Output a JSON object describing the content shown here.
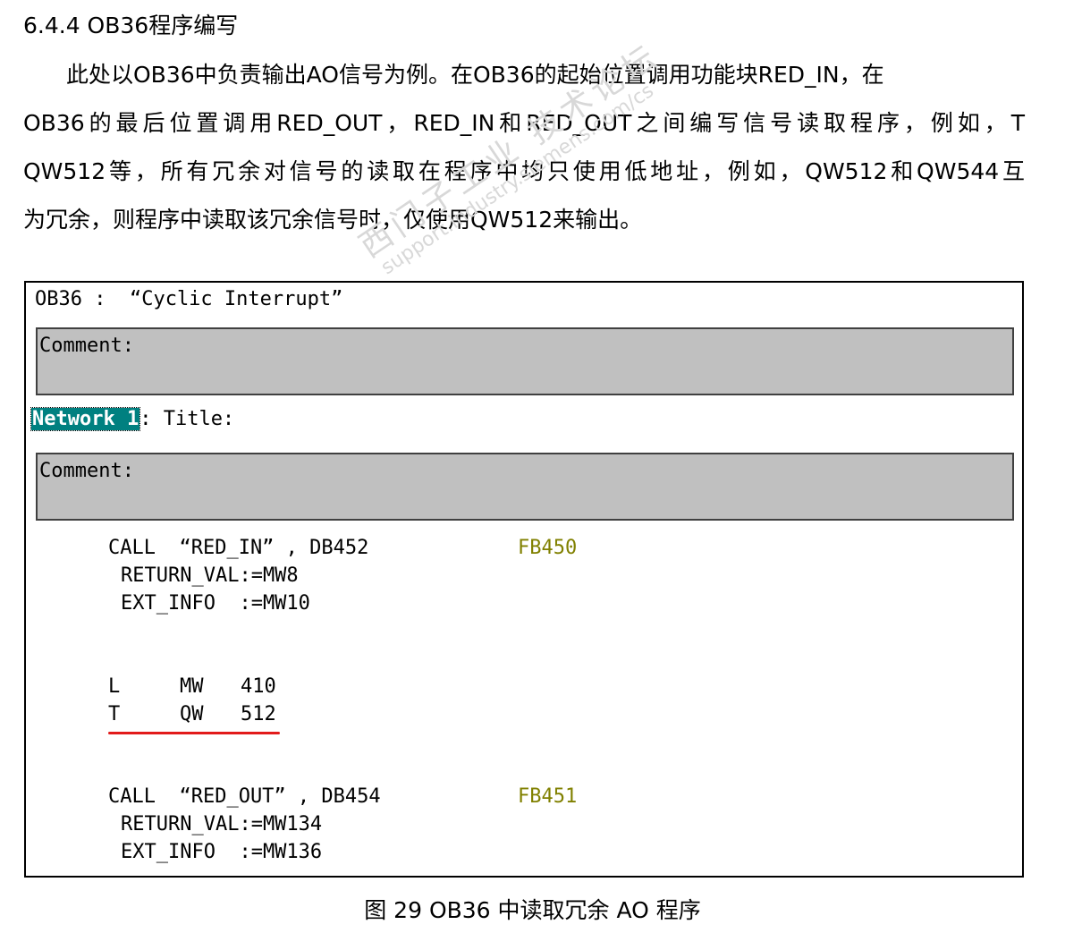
{
  "section": {
    "heading": "6.4.4 OB36程序编写"
  },
  "paragraph": {
    "lines": [
      "此处以OB36中负责输出AO信号为例。在OB36的起始位置调用功能块RED_IN，在",
      "OB36的最后位置调用RED_OUT，RED_IN和RED_OUT之间编写信号读取程序，例如，T",
      "QW512等，所有冗余对信号的读取在程序中均只使用低地址，例如，QW512和QW544互",
      "为冗余，则程序中读取该冗余信号时，仅使用QW512来输出。"
    ]
  },
  "figure": {
    "ob_title": "OB36 :  “Cyclic Interrupt”",
    "comment1": "Comment:",
    "network_label": "Network 1",
    "network_title": ": Title:",
    "comment2": "Comment:",
    "call1": {
      "code": "CALL  “RED_IN” , DB452",
      "fb": "FB450",
      "p1": "RETURN_VAL:=MW8",
      "p2": "EXT_INFO  :=MW10"
    },
    "load": {
      "op": "L",
      "addr": "MW",
      "num": "410"
    },
    "transfer": {
      "op": "T",
      "addr": "QW",
      "num": "512"
    },
    "call2": {
      "code": "CALL  “RED_OUT” , DB454",
      "fb": "FB451",
      "p1": "RETURN_VAL:=MW134",
      "p2": "EXT_INFO  :=MW136"
    },
    "watermark_cn": "西门子工业 技术论坛",
    "watermark_url": "support.industry.siemens.com/cs",
    "highlight_color": "#e21b1b"
  },
  "caption": "图 29 OB36 中读取冗余 AO 程序"
}
